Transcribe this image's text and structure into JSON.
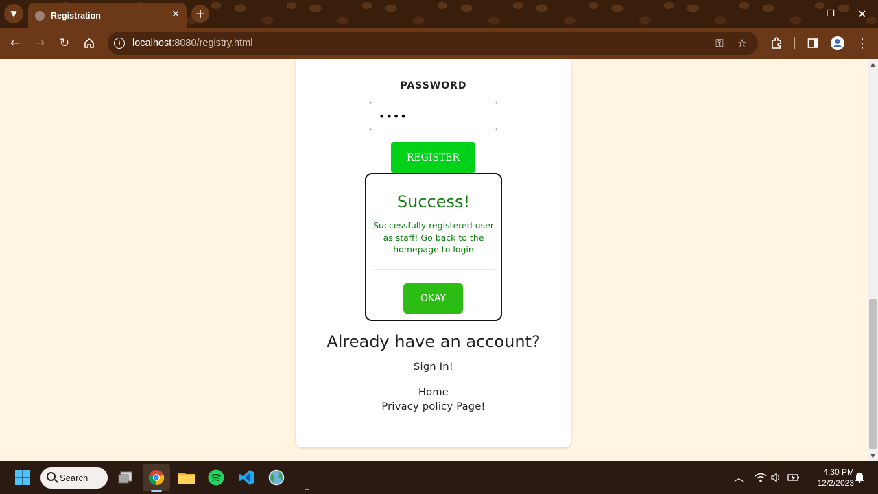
{
  "browser": {
    "tab_title": "Registration",
    "url_host": "localhost",
    "url_rest": ":8080/registry.html"
  },
  "page": {
    "password_label": "PASSWORD",
    "password_value": "••••",
    "register_button": "REGISTER",
    "modal": {
      "title": "Success!",
      "message": "Successfully registered user as staff! Go back to the homepage to login",
      "okay_button": "OKAY"
    },
    "already_heading": "Already have an account?",
    "sign_in_link": "Sign In!",
    "home_link": "Home",
    "privacy_link": "Privacy policy Page!"
  },
  "taskbar": {
    "search_label": "Search",
    "time": "4:30 PM",
    "date": "12/2/2023"
  },
  "colors": {
    "page_bg": "#fff5e1",
    "register_green": "#00d21a",
    "okay_green": "#2cbd15",
    "success_text": "#0f7c10",
    "chrome_brown": "#6b3818"
  }
}
